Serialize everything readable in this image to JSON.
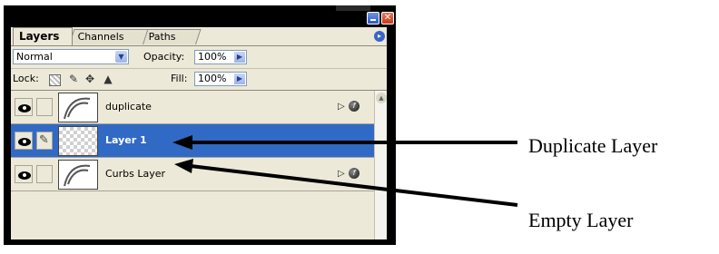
{
  "window": {
    "minimize_icon": "minimize-icon",
    "close_glyph": "✕"
  },
  "tabs": [
    {
      "label": "Layers",
      "active": true
    },
    {
      "label": "Channels",
      "active": false
    },
    {
      "label": "Paths",
      "active": false
    }
  ],
  "palette_menu_glyph": "▸",
  "blend": {
    "mode": "Normal",
    "opacity_label": "Opacity:",
    "opacity_value": "100%"
  },
  "lock": {
    "label": "Lock:",
    "fill_label": "Fill:",
    "fill_value": "100%"
  },
  "layers": [
    {
      "name": "duplicate",
      "visible": true,
      "selected": false,
      "has_effects": true
    },
    {
      "name": "Layer 1",
      "visible": true,
      "selected": true,
      "has_effects": false
    },
    {
      "name": "Curbs Layer",
      "visible": true,
      "selected": false,
      "has_effects": true
    }
  ],
  "annotations": {
    "duplicate": "Duplicate Layer",
    "empty": "Empty Layer"
  },
  "colors": {
    "selection": "#316ac5",
    "palette_bg": "#ece9d8",
    "frame": "#000000"
  }
}
